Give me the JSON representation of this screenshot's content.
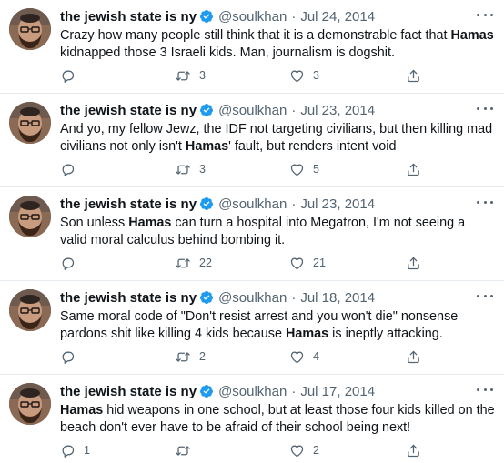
{
  "tweets": [
    {
      "name": "the jewish state is ny",
      "handle": "@soulkhan",
      "separator": "·",
      "date": "Jul 24, 2014",
      "text": [
        {
          "t": "Crazy how many people still think that it is a demonstrable fact that ",
          "b": false
        },
        {
          "t": "Hamas",
          "b": true
        },
        {
          "t": " kidnapped those 3 Israeli kids. Man, journalism is dogshit.",
          "b": false
        }
      ],
      "replies": "",
      "retweets": "3",
      "likes": "3"
    },
    {
      "name": "the jewish state is ny",
      "handle": "@soulkhan",
      "separator": "·",
      "date": "Jul 23, 2014",
      "text": [
        {
          "t": "And yo, my fellow Jewz, the IDF not targeting civilians, but then killing mad civilians not only isn't ",
          "b": false
        },
        {
          "t": "Hamas",
          "b": true
        },
        {
          "t": "' fault, but renders intent void",
          "b": false
        }
      ],
      "replies": "",
      "retweets": "3",
      "likes": "5"
    },
    {
      "name": "the jewish state is ny",
      "handle": "@soulkhan",
      "separator": "·",
      "date": "Jul 23, 2014",
      "text": [
        {
          "t": "Son unless ",
          "b": false
        },
        {
          "t": "Hamas",
          "b": true
        },
        {
          "t": " can turn a hospital into Megatron, I'm not seeing a valid moral calculus behind bombing it.",
          "b": false
        }
      ],
      "replies": "",
      "retweets": "22",
      "likes": "21"
    },
    {
      "name": "the jewish state is ny",
      "handle": "@soulkhan",
      "separator": "·",
      "date": "Jul 18, 2014",
      "text": [
        {
          "t": "Same moral code of \"Don't resist arrest and you won't die\" nonsense pardons shit like killing 4 kids because ",
          "b": false
        },
        {
          "t": "Hamas",
          "b": true
        },
        {
          "t": " is ineptly attacking.",
          "b": false
        }
      ],
      "replies": "",
      "retweets": "2",
      "likes": "4"
    },
    {
      "name": "the jewish state is ny",
      "handle": "@soulkhan",
      "separator": "·",
      "date": "Jul 17, 2014",
      "text": [
        {
          "t": "Hamas",
          "b": true
        },
        {
          "t": " hid weapons in one school, but at least those four kids killed on the beach don't ever have to be afraid of their school being next!",
          "b": false
        }
      ],
      "replies": "1",
      "retweets": "",
      "likes": "2"
    }
  ],
  "icons": {
    "reply": "reply-icon",
    "retweet": "retweet-icon",
    "like": "heart-icon",
    "share": "share-icon",
    "verified": "verified-badge-icon",
    "more": "more-options-icon"
  },
  "colors": {
    "text": "#0f1419",
    "muted": "#536471",
    "verified": "#1d9bf0",
    "divider": "#e6ecf0"
  }
}
